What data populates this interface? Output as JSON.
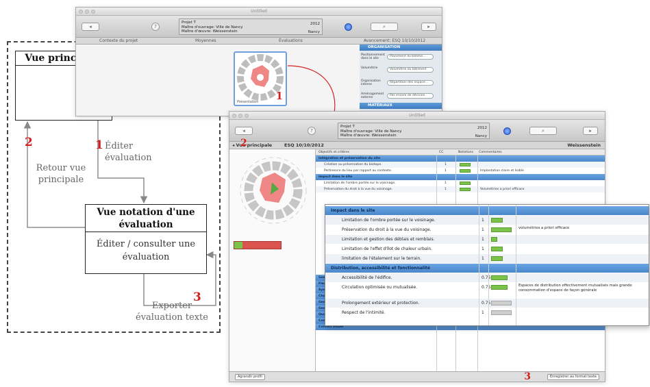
{
  "flow": {
    "vue_principale": "Vue principale",
    "vue_notation": "Vue notation d'une évaluation",
    "editer_consulter": "Éditer / consulter une évaluation",
    "steps": [
      {
        "num": "1",
        "label": "Éditer évaluation"
      },
      {
        "num": "2",
        "label": "Retour vue principale"
      },
      {
        "num": "3",
        "label": "Exporter évaluation texte"
      }
    ]
  },
  "window1": {
    "title": "Untitled",
    "project": {
      "line1": "Projet T",
      "line2": "Maître d'ouvrage: Ville de Nancy",
      "line3": "Maître d'œuvre: Weissenstein",
      "year": "2012",
      "city": "Nancy"
    },
    "tabs": [
      "Contexte du projet",
      "Moyennes",
      "Évaluations",
      "Avancement: ESQ 10/10/2012"
    ],
    "thumb_label": "Présentation",
    "thumb_num": "1",
    "side_sections": [
      "ORGANISATION",
      "MATÉRIAUX"
    ],
    "side_rows": [
      {
        "label": "Positionnement dans le site",
        "value": "Placement du bâtime..."
      },
      {
        "label": "Volumétrie",
        "value": "Volumétrie du bâtiment"
      },
      {
        "label": "Organisation interne",
        "value": "Répartition des espace..."
      },
      {
        "label": "Aménagement externe",
        "value": "Pas encore de décision"
      }
    ]
  },
  "window2": {
    "title": "Untitled",
    "project": {
      "line1": "Projet T",
      "line2": "Maître d'ouvrage: Ville de Nancy",
      "line3": "Maître d'œuvre: Weissenstein",
      "year": "2012",
      "city": "Nancy"
    },
    "breadcrumb_back": "◂ Vue principale",
    "breadcrumb_num": "2",
    "breadcrumb_phase": "ESQ 10/10/2012",
    "breadcrumb_right": "Weissenstein",
    "columns": [
      "Objectifs et critères",
      "CC",
      "Notations",
      "Commentaires"
    ],
    "rows": [
      {
        "type": "sec",
        "text": "Intégration et préservation du site"
      },
      {
        "type": "row",
        "text": "Création ou préservation du biotope.",
        "cc": "1"
      },
      {
        "type": "row",
        "text": "Pertinence du lieu par rapport au contexte.",
        "cc": "1",
        "comment": "Implantation claire et lisible"
      },
      {
        "type": "sec",
        "text": "Impact dans le site"
      },
      {
        "type": "row",
        "text": "Limitation de l'ombre portée sur le voisinage.",
        "cc": "1"
      },
      {
        "type": "row",
        "text": "Préservation du droit à la vue du voisinage.",
        "cc": "1",
        "comment": "Volumétries a priori efficace"
      },
      {
        "type": "sec",
        "text": "Gestion des déchets de chantier"
      },
      {
        "type": "sec",
        "text": "Flexibilité et adaptabilité"
      },
      {
        "type": "sec",
        "text": "Système constructif"
      },
      {
        "type": "sec",
        "text": "Choix des matériaux"
      },
      {
        "type": "sec",
        "text": "Gestion de l'eau"
      },
      {
        "type": "sec",
        "text": "Gestion de l'énergie et confort thermique"
      },
      {
        "type": "sec",
        "text": "Qualité de l'air"
      },
      {
        "type": "sec",
        "text": "Confort acoustique"
      },
      {
        "type": "sec",
        "text": "Confort visuel"
      }
    ],
    "footer_left": "Agrandir profil",
    "footer_num": "3",
    "footer_right": "Enregistrer au format texte"
  },
  "zoom": {
    "rows": [
      {
        "type": "sec",
        "text": "Impact dans le site"
      },
      {
        "type": "row",
        "text": "Limitation de l'ombre portée sur le voisinage.",
        "n": "1",
        "chip": 0.55
      },
      {
        "type": "row",
        "text": "Préservation du droit à la vue du voisinage.",
        "n": "1",
        "chip": 1.0,
        "comment": "volumétries a priori efficace"
      },
      {
        "type": "row",
        "text": "Limitation et gestion des déblais et remblais.",
        "n": "1",
        "chip": 0.3
      },
      {
        "type": "row",
        "text": "Limitation de l'effet d'îlot de chaleur urbain.",
        "n": "1",
        "chip": 0.55
      },
      {
        "type": "row",
        "text": "limitation de l'étalement sur le terrain.",
        "n": "1",
        "chip": 0.55
      },
      {
        "type": "sec",
        "text": "Distribution, accessibilité et fonctionnalité"
      },
      {
        "type": "row",
        "text": "Accessibilité de l'édifice.",
        "n": "0.75",
        "chip": 0.8
      },
      {
        "type": "row",
        "text": "Circulation optimisée ou mutualisée.",
        "n": "0.75",
        "chip": 0.8,
        "comment": "Espaces de distribution effectivement mutualisés mais grande consommation d'espace de façon générale"
      },
      {
        "type": "row",
        "text": "Prolongement extérieur et protection.",
        "n": "0.75",
        "chip": 0.0
      },
      {
        "type": "row",
        "text": "Respect de l'intimité.",
        "n": "1",
        "chip": 0.0
      }
    ]
  },
  "colors": {
    "red": "#d61f1f",
    "blue": "#4a87cc",
    "green": "#7cc34a",
    "pink": "#f08787"
  }
}
